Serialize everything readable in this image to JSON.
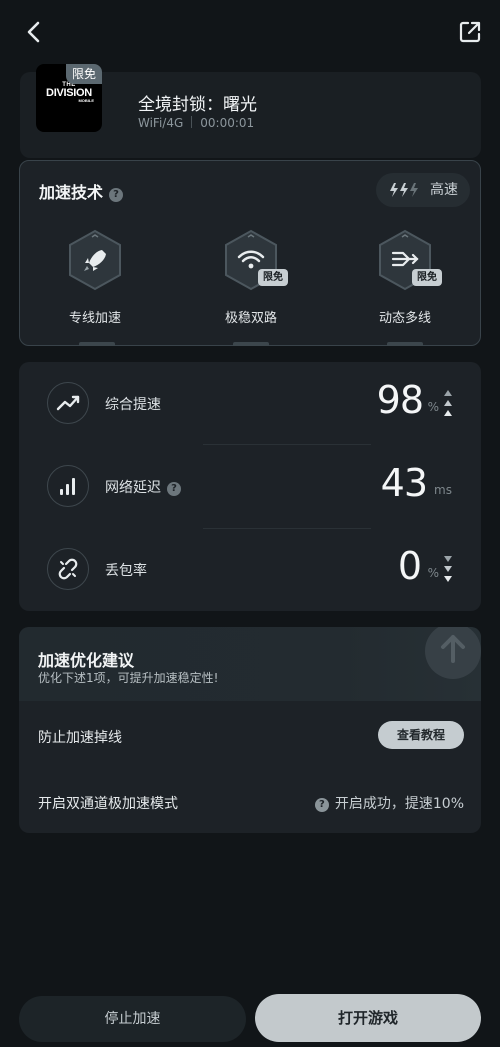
{
  "header": {
    "back_icon": "chevron-left-icon",
    "share_icon": "external-link-icon"
  },
  "game": {
    "title": "全境封锁：曙光",
    "cover_badge": "限免",
    "cover_logo_top": "THE",
    "cover_logo_main": "DIVISION",
    "cover_logo_bottom": "MOBILE",
    "network": "WiFi/4G",
    "duration": "00:00:01"
  },
  "tech": {
    "title": "加速技术",
    "speed_label": "高速",
    "items": [
      {
        "label": "专线加速",
        "icon": "rocket-icon",
        "badge": ""
      },
      {
        "label": "极稳双路",
        "icon": "wifi-icon",
        "badge": "限免"
      },
      {
        "label": "动态多线",
        "icon": "multiline-icon",
        "badge": "限免"
      }
    ]
  },
  "stats": [
    {
      "label": "综合提速",
      "value": "98",
      "unit": "%",
      "icon": "trend-up-icon",
      "has_help": false,
      "trend": "up"
    },
    {
      "label": "网络延迟",
      "value": "43",
      "unit": "ms",
      "icon": "signal-bars-icon",
      "has_help": true,
      "trend": ""
    },
    {
      "label": "丢包率",
      "value": "0",
      "unit": "%",
      "icon": "link-broken-icon",
      "has_help": false,
      "trend": "down"
    }
  ],
  "advice": {
    "title": "加速优化建议",
    "subtitle": "优化下述1项，可提升加速稳定性!",
    "row1_label": "防止加速掉线",
    "row1_button": "查看教程",
    "row2_label": "开启双通道极加速模式",
    "row2_status": "开启成功，提速10%"
  },
  "footer": {
    "stop_label": "停止加速",
    "open_label": "打开游戏"
  },
  "colors": {
    "background": "#111518",
    "card": "#1d2227",
    "accent_light": "#c3c9cc"
  }
}
